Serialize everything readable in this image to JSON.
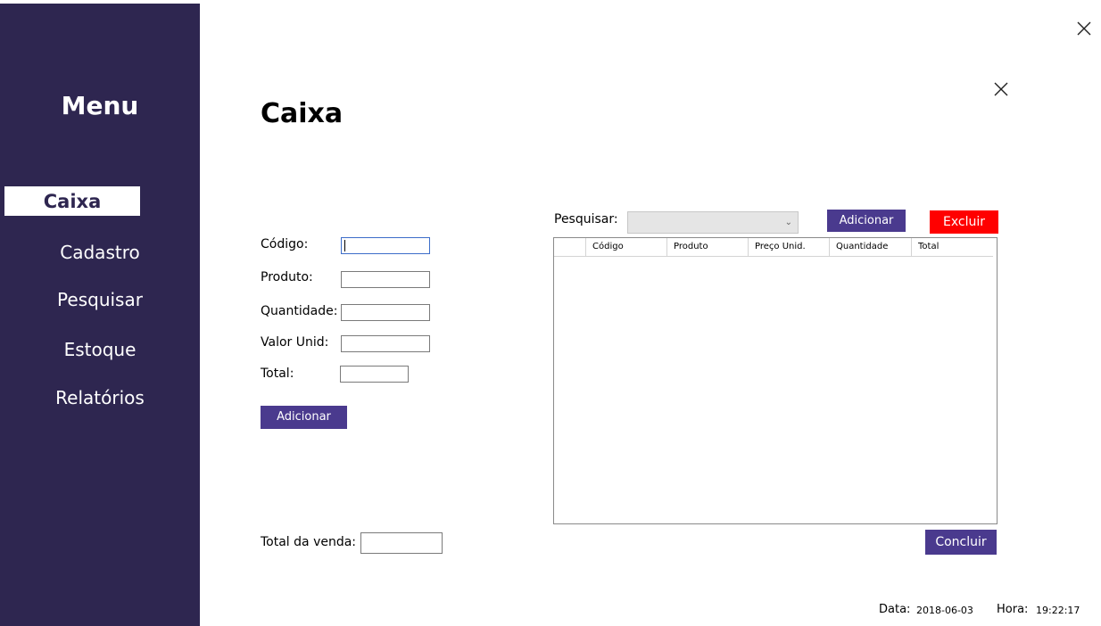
{
  "sidebar": {
    "title": "Menu",
    "items": [
      {
        "label": "Caixa"
      },
      {
        "label": "Cadastro"
      },
      {
        "label": "Pesquisar"
      },
      {
        "label": "Estoque"
      },
      {
        "label": "Relatórios"
      }
    ]
  },
  "page": {
    "title": "Caixa"
  },
  "form": {
    "codigo_label": "Código:",
    "produto_label": "Produto:",
    "quantidade_label": "Quantidade:",
    "valor_unid_label": "Valor Unid:",
    "total_label": "Total:",
    "add_button": "Adicionar",
    "total_venda_label": "Total da venda:"
  },
  "search": {
    "label": "Pesquisar:",
    "add_button": "Adicionar",
    "delete_button": "Excluir"
  },
  "table": {
    "columns": [
      "Código",
      "Produto",
      "Preço Unid.",
      "Quantidade",
      "Total"
    ]
  },
  "actions": {
    "conclude_button": "Concluir"
  },
  "status": {
    "date_label": "Data:",
    "date_value": "2018-06-03",
    "time_label": "Hora:",
    "time_value": "19:22:17"
  },
  "colors": {
    "sidebar_bg": "#2e2650",
    "button_bg": "#4a3a8e",
    "delete_bg": "#ff0000"
  },
  "icons": {
    "close": "close-icon",
    "dropdown": "chevron-down-icon"
  }
}
